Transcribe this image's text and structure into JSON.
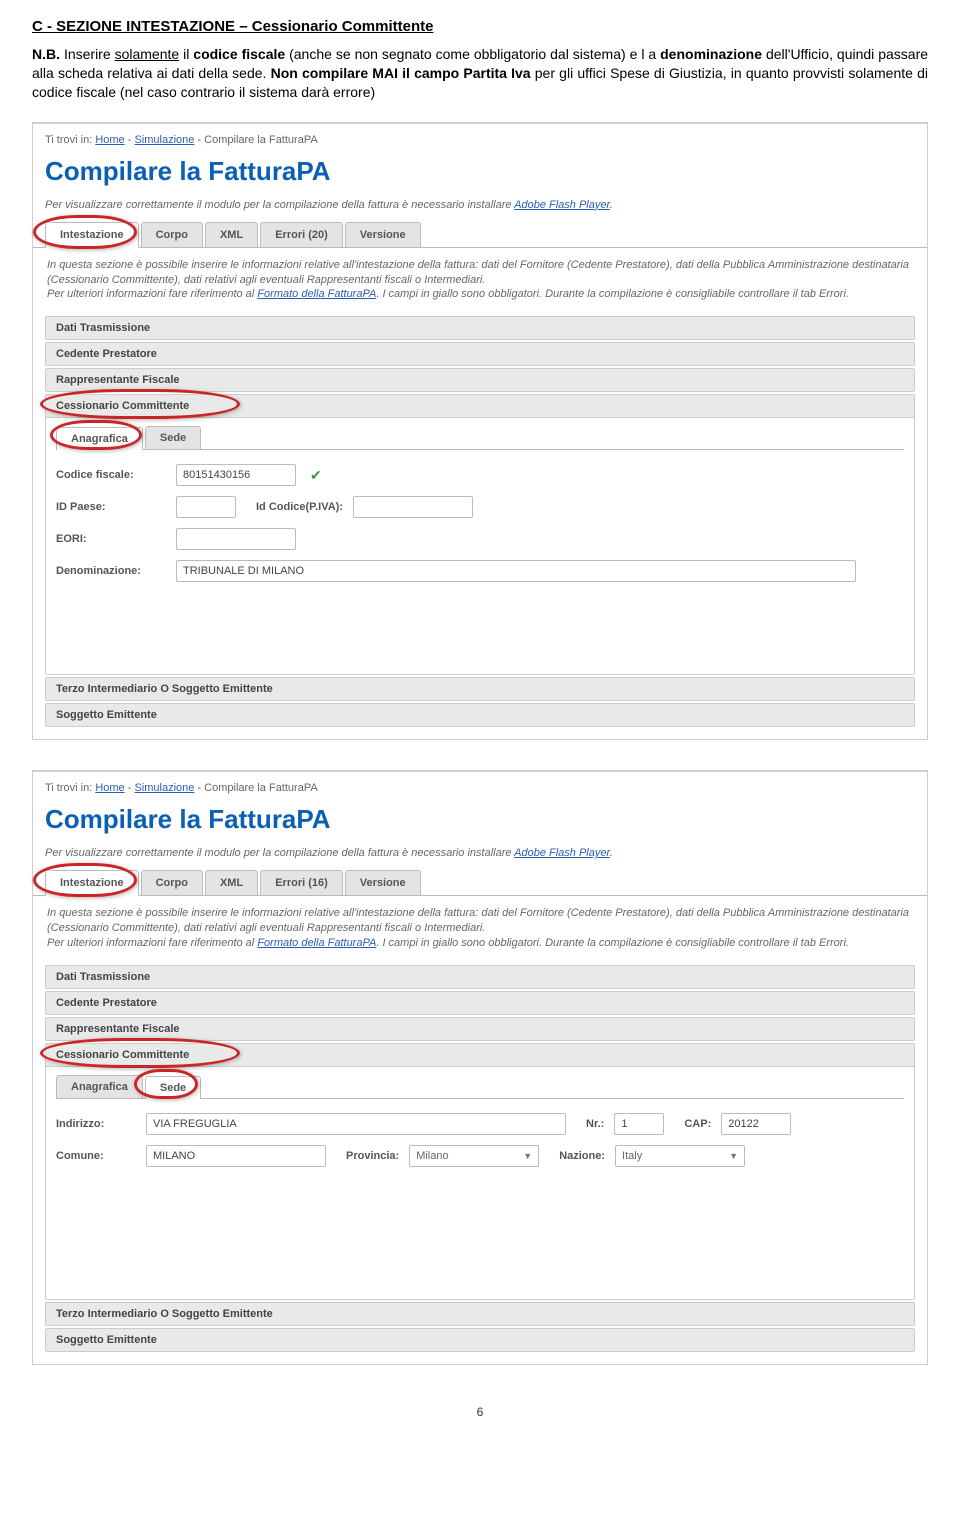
{
  "doc": {
    "title": "C - SEZIONE INTESTAZIONE – Cessionario Committente",
    "para_pre": "N.B.",
    "para_1a": " Inserire ",
    "para_1b_u": "solamente",
    "para_1c": " il ",
    "para_1d_b": "codice fiscale",
    "para_1e": " (anche se non segnato come obbligatorio dal sistema) e l a ",
    "para_1f_b": "denominazione",
    "para_1g": " dell'Ufficio, quindi passare alla scheda relativa ai dati della sede. ",
    "para_1h_b": "Non compilare MAI il campo Partita Iva",
    "para_1i": " per gli uffici Spese di Giustizia, in quanto provvisti solamente di codice fiscale (nel caso contrario il sistema darà errore)",
    "page_num": "6"
  },
  "s1": {
    "breadcrumb_prefix": "Ti trovi in: ",
    "bc_home": "Home",
    "bc_sim": "Simulazione",
    "bc_last": " - Compilare la FatturaPA",
    "heading": "Compilare la FatturaPA",
    "info_pre": "Per visualizzare correttamente il modulo per la compilazione della fattura è necessario installare ",
    "info_link": "Adobe Flash Player",
    "info_post": ".",
    "tabs": [
      "Intestazione",
      "Corpo",
      "XML",
      "Errori (20)",
      "Versione"
    ],
    "desc1": "In questa sezione è possibile inserire le informazioni relative all'intestazione della fattura: dati del Fornitore (Cedente Prestatore), dati della Pubblica Amministrazione destinataria (Cessionario Committente), dati relativi agli eventuali Rappresentanti fiscali o Intermediari.",
    "desc2_pre": "Per ulteriori informazioni fare riferimento al ",
    "desc2_link": "Formato della FatturaPA",
    "desc2_post": ". I campi in giallo sono obbligatori. Durante la compilazione è consigliabile controllare il tab Errori.",
    "acc": [
      "Dati Trasmissione",
      "Cedente Prestatore",
      "Rappresentante Fiscale",
      "Cessionario Committente"
    ],
    "subtabs": [
      "Anagrafica",
      "Sede"
    ],
    "labels": {
      "codfisc": "Codice fiscale:",
      "idpaese": "ID Paese:",
      "idcod": "Id Codice(P.IVA):",
      "eori": "EORI:",
      "denom": "Denominazione:"
    },
    "values": {
      "codfisc": "80151430156",
      "denom": "TRIBUNALE DI MILANO"
    },
    "acc_bottom": [
      "Terzo Intermediario O Soggetto Emittente",
      "Soggetto Emittente"
    ]
  },
  "s2": {
    "breadcrumb_prefix": "Ti trovi in: ",
    "bc_home": "Home",
    "bc_sim": "Simulazione",
    "bc_last": " - Compilare la FatturaPA",
    "heading": "Compilare la FatturaPA",
    "info_pre": "Per visualizzare correttamente il modulo per la compilazione della fattura è necessario installare ",
    "info_link": "Adobe Flash Player",
    "info_post": ".",
    "tabs": [
      "Intestazione",
      "Corpo",
      "XML",
      "Errori (16)",
      "Versione"
    ],
    "desc1": "In questa sezione è possibile inserire le informazioni relative all'intestazione della fattura: dati del Fornitore (Cedente Prestatore), dati della Pubblica Amministrazione destinataria (Cessionario Committente), dati relativi agli eventuali Rappresentanti fiscali o Intermediari.",
    "desc2_pre": "Per ulteriori informazioni fare riferimento al ",
    "desc2_link": "Formato della FatturaPA",
    "desc2_post": ". I campi in giallo sono obbligatori. Durante la compilazione è consigliabile controllare il tab Errori.",
    "acc": [
      "Dati Trasmissione",
      "Cedente Prestatore",
      "Rappresentante Fiscale",
      "Cessionario Committente"
    ],
    "subtabs": [
      "Anagrafica",
      "Sede"
    ],
    "labels": {
      "indirizzo": "Indirizzo:",
      "nr": "Nr.:",
      "cap": "CAP:",
      "comune": "Comune:",
      "prov": "Provincia:",
      "naz": "Nazione:"
    },
    "values": {
      "indirizzo": "VIA FREGUGLIA",
      "nr": "1",
      "cap": "20122",
      "comune": "MILANO",
      "prov": "Milano",
      "naz": "Italy"
    },
    "acc_bottom": [
      "Terzo Intermediario O Soggetto Emittente",
      "Soggetto Emittente"
    ]
  }
}
